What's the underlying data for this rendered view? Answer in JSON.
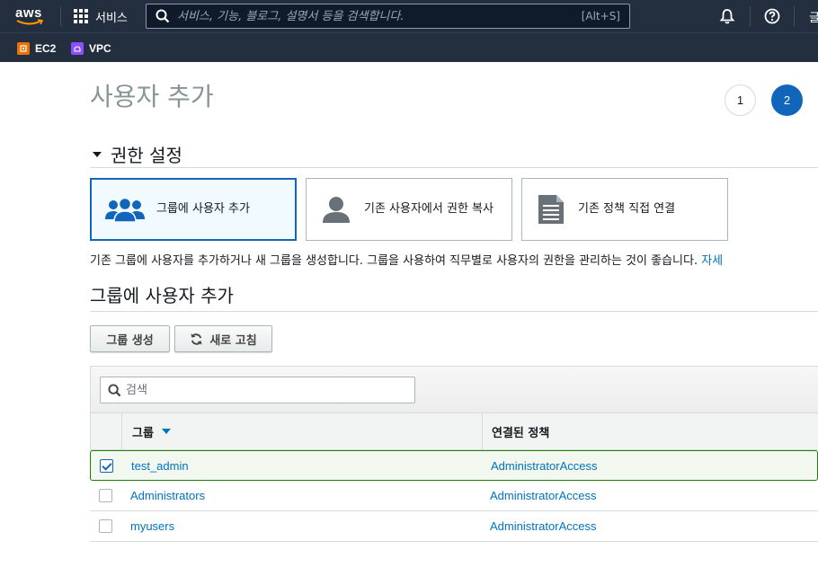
{
  "nav": {
    "logo_text": "aws",
    "services_label": "서비스",
    "search_placeholder": "서비스, 기능, 블로그, 설명서 등을 검색합니다.",
    "search_shortcut": "[Alt+S]",
    "cut_text": "글"
  },
  "favorites": [
    {
      "label": "EC2",
      "color": "#ed7100"
    },
    {
      "label": "VPC",
      "color": "#8c4fff"
    }
  ],
  "page": {
    "title": "사용자 추가",
    "steps": [
      "1",
      "2"
    ],
    "active_step": "2"
  },
  "permissions": {
    "section_title": "권한 설정",
    "options": [
      {
        "label": "그룹에 사용자 추가",
        "selected": true
      },
      {
        "label": "기존 사용자에서 권한 복사",
        "selected": false
      },
      {
        "label": "기존 정책 직접 연결",
        "selected": false
      }
    ],
    "description": "기존 그룹에 사용자를 추가하거나 새 그룹을 생성합니다. 그룹을 사용하여 직무별로 사용자의 권한을 관리하는 것이 좋습니다.",
    "learn_more": "자세"
  },
  "groups": {
    "title": "그룹에 사용자 추가",
    "create_button": "그룹 생성",
    "refresh_button": "새로 고침",
    "filter_placeholder": "검색",
    "columns": [
      "그룹",
      "연결된 정책"
    ],
    "rows": [
      {
        "group": "test_admin",
        "policy": "AdministratorAccess",
        "checked": true
      },
      {
        "group": "Administrators",
        "policy": "AdministratorAccess",
        "checked": false
      },
      {
        "group": "myusers",
        "policy": "AdministratorAccess",
        "checked": false
      }
    ]
  },
  "colors": {
    "nav_bg": "#232f3e",
    "accent": "#1166bb",
    "link": "#0073bb",
    "selected_row_border": "#1d8102"
  }
}
